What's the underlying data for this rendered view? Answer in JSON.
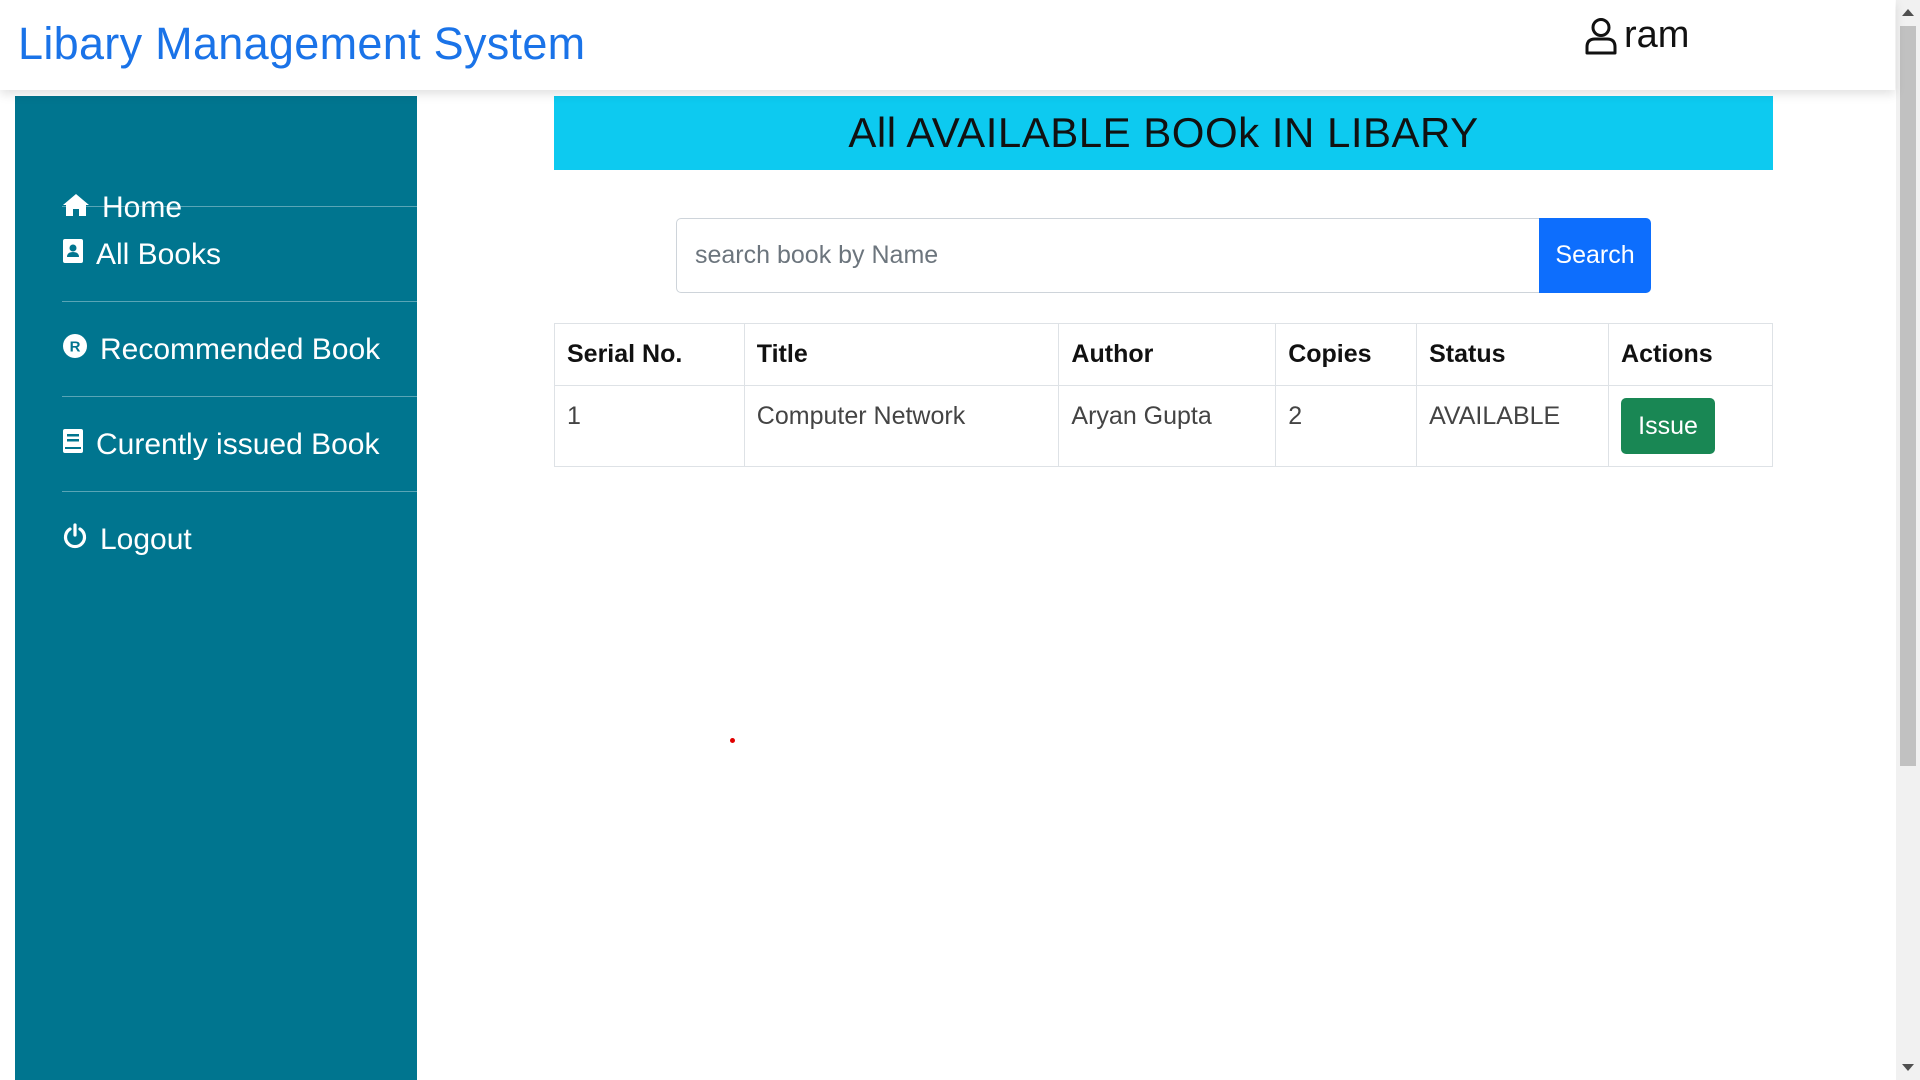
{
  "header": {
    "brand": "Libary Management System",
    "user_name": "ram",
    "user_icon": "user-icon"
  },
  "sidebar": {
    "items": [
      {
        "label": "Home",
        "icon": "home-icon"
      },
      {
        "label": "All Books",
        "icon": "address-book-icon"
      },
      {
        "label": "Recommended Book",
        "icon": "registered-icon"
      },
      {
        "label": "Curently issued Book",
        "icon": "book-icon"
      },
      {
        "label": "Logout",
        "icon": "power-icon"
      }
    ]
  },
  "main": {
    "banner": "All AVAILABLE BOOk IN LIBARY",
    "search": {
      "placeholder": "search book by Name",
      "value": "",
      "button_label": "Search"
    },
    "table": {
      "columns": [
        "Serial No.",
        "Title",
        "Author",
        "Copies",
        "Status",
        "Actions"
      ],
      "rows": [
        {
          "serial": "1",
          "title": "Computer Network",
          "author": "Aryan Gupta",
          "copies": "2",
          "status": "AVAILABLE",
          "action_label": "Issue"
        }
      ]
    }
  },
  "colors": {
    "brand": "#1a73e8",
    "sidebar_bg": "#00758f",
    "banner_bg": "#0dcaf0",
    "search_button": "#0d6efd",
    "issue_button": "#198754"
  }
}
